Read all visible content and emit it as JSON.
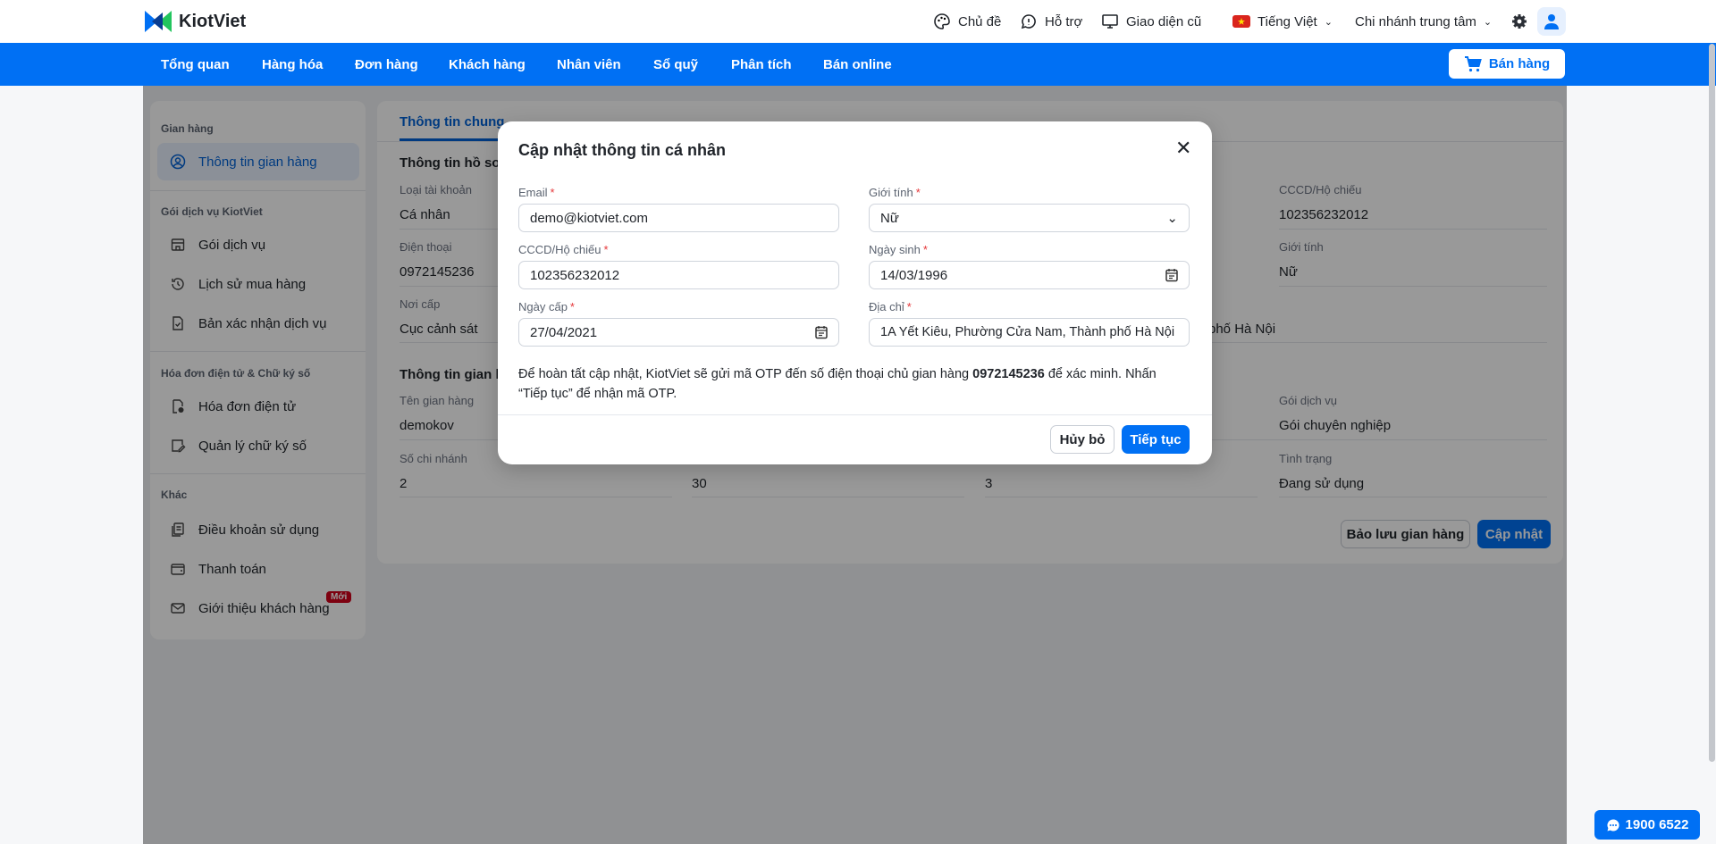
{
  "brand": {
    "name": "KiotViet",
    "primary": "#0070f4"
  },
  "header": {
    "theme": "Chủ đề",
    "support": "Hỗ trợ",
    "old_ui": "Giao diện cũ",
    "language": "Tiếng Việt",
    "branch": "Chi nhánh trung tâm"
  },
  "nav": {
    "items": [
      "Tổng quan",
      "Hàng hóa",
      "Đơn hàng",
      "Khách hàng",
      "Nhân viên",
      "Sổ quỹ",
      "Phân tích",
      "Bán online"
    ],
    "sell_button": "Bán hàng"
  },
  "sidebar": {
    "groups": [
      {
        "title": "Gian hàng",
        "items": [
          {
            "label": "Thông tin gian hàng",
            "icon": "user-circle-icon",
            "active": true
          }
        ]
      },
      {
        "title": "Gói dịch vụ KiotViet",
        "items": [
          {
            "label": "Gói dịch vụ",
            "icon": "store-icon"
          },
          {
            "label": "Lịch sử mua hàng",
            "icon": "history-icon"
          },
          {
            "label": "Bản xác nhận dịch vụ",
            "icon": "document-check-icon"
          }
        ]
      },
      {
        "title": "Hóa đơn điện tử & Chữ ký số",
        "items": [
          {
            "label": "Hóa đơn điện tử",
            "icon": "invoice-icon"
          },
          {
            "label": "Quản lý chữ ký số",
            "icon": "signature-icon"
          }
        ]
      },
      {
        "title": "Khác",
        "items": [
          {
            "label": "Điều khoản sử dụng",
            "icon": "terms-icon"
          },
          {
            "label": "Thanh toán",
            "icon": "wallet-icon"
          },
          {
            "label": "Giới thiệu khách hàng",
            "icon": "mail-icon",
            "badge": "Mới"
          }
        ]
      }
    ]
  },
  "main": {
    "tab_active": "Thông tin chung",
    "profile": {
      "title": "Thông tin hồ sơ",
      "account_type_label": "Loại tài khoản",
      "account_type": "Cá nhân",
      "phone_label": "Điện thoại",
      "phone": "0972145236",
      "issued_by_label": "Nơi cấp",
      "issued_by": "Cục cảnh sát",
      "id_label": "CCCD/Hộ chiếu",
      "id": "102356232012",
      "gender_label": "Giới tính",
      "gender": "Nữ",
      "address_tail": "phố Hà Nội"
    },
    "store": {
      "title": "Thông tin gian hàng",
      "name_label": "Tên gian hàng",
      "name": "demokov",
      "plan_label": "Gói dịch vụ",
      "plan": "Gói chuyên nghiệp",
      "branches_label": "Số chi nhánh",
      "branches": "2",
      "col2_value": "30",
      "col3_value": "3",
      "status_label": "Tình trạng",
      "status": "Đang sử dụng"
    },
    "backup_button": "Bảo lưu gian hàng",
    "update_button": "Cập nhật"
  },
  "modal": {
    "title": "Cập nhật thông tin cá nhân",
    "fields": {
      "email": {
        "label": "Email",
        "value": "demo@kiotviet.com"
      },
      "gender": {
        "label": "Giới tính",
        "value": "Nữ"
      },
      "id": {
        "label": "CCCD/Hộ chiếu",
        "value": "102356232012"
      },
      "dob": {
        "label": "Ngày sinh",
        "value": "14/03/1996"
      },
      "issue_date": {
        "label": "Ngày cấp",
        "value": "27/04/2021"
      },
      "address": {
        "label": "Địa chỉ",
        "value": "1A Yết Kiêu, Phường Cửa Nam, Thành phố Hà Nội"
      }
    },
    "required_mark": "*",
    "note_pre": "Để hoàn tất cập nhật, KiotViet sẽ gửi mã OTP đến số điện thoại chủ gian hàng ",
    "note_phone": "0972145236",
    "note_post": " để xác minh. Nhấn “Tiếp tục” để nhận mã OTP.",
    "cancel": "Hủy bỏ",
    "continue": "Tiếp tục"
  },
  "hotline": "1900 6522"
}
